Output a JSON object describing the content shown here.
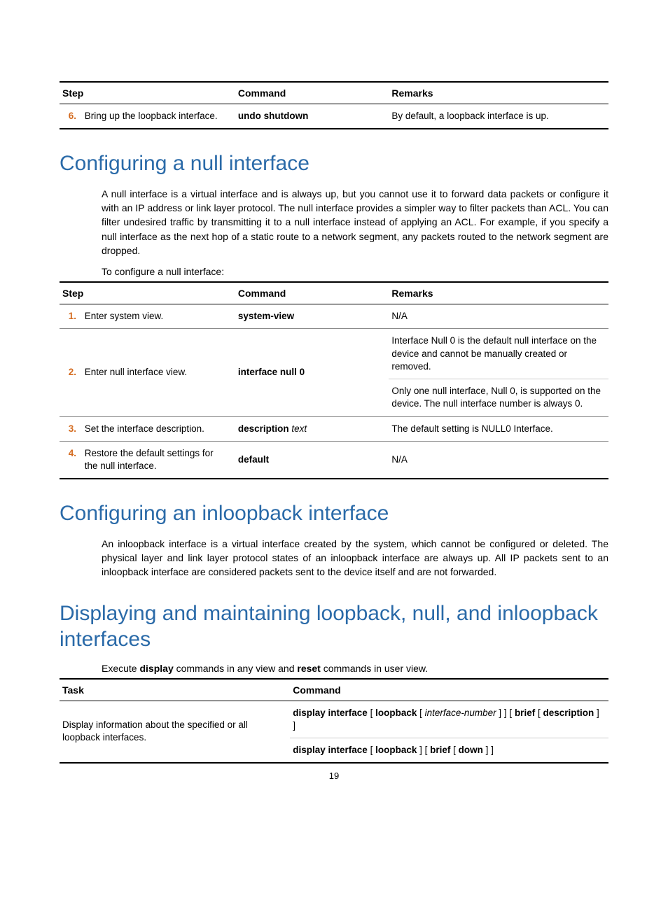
{
  "table1": {
    "headers": {
      "step": "Step",
      "command": "Command",
      "remarks": "Remarks"
    },
    "rows": [
      {
        "num": "6.",
        "step": "Bring up the loopback interface.",
        "command_bold": "undo shutdown",
        "remarks": "By default, a loopback interface is up."
      }
    ]
  },
  "section1": {
    "title": "Configuring a null interface",
    "para": "A null interface is a virtual interface and is always up, but you cannot use it to forward data packets or configure it with an IP address or link layer protocol. The null interface provides a simpler way to filter packets than ACL. You can filter undesired traffic by transmitting it to a null interface instead of applying an ACL. For example, if you specify a null interface as the next hop of a static route to a network segment, any packets routed to the network segment are dropped.",
    "lead": "To configure a null interface:"
  },
  "table2": {
    "headers": {
      "step": "Step",
      "command": "Command",
      "remarks": "Remarks"
    },
    "rows": [
      {
        "num": "1.",
        "step": "Enter system view.",
        "command_bold": "system-view",
        "remarks": "N/A"
      },
      {
        "num": "2.",
        "step": "Enter null interface view.",
        "command_bold": "interface null 0",
        "remarks_a": "Interface Null 0 is the default null interface on the device and cannot be manually created or removed.",
        "remarks_b": "Only one null interface, Null 0, is supported on the device. The null interface number is always 0."
      },
      {
        "num": "3.",
        "step": "Set the interface description.",
        "command_bold": "description",
        "command_ital": "text",
        "remarks": "The default setting is NULL0 Interface."
      },
      {
        "num": "4.",
        "step": "Restore the default settings for the null interface.",
        "command_bold": "default",
        "remarks": "N/A"
      }
    ]
  },
  "section2": {
    "title": "Configuring an inloopback interface",
    "para": "An inloopback interface is a virtual interface created by the system, which cannot be configured or deleted. The physical layer and link layer protocol states of an inloopback interface are always up. All IP packets sent to an inloopback interface are considered packets sent to the device itself and are not forwarded."
  },
  "section3": {
    "title": "Displaying and maintaining loopback, null, and inloopback interfaces",
    "lead_pre": "Execute ",
    "lead_b1": "display",
    "lead_mid": " commands in any view and ",
    "lead_b2": "reset",
    "lead_post": " commands in user view."
  },
  "table3": {
    "headers": {
      "task": "Task",
      "command": "Command"
    },
    "rows": [
      {
        "task": "Display information about the specified or all loopback interfaces.",
        "cmd_a": {
          "t1": "display interface",
          "t2": " [ ",
          "t3": "loopback",
          "t4": " [ ",
          "t5": "interface-number",
          "t6": " ] ] [ ",
          "t7": "brief",
          "t8": " [ ",
          "t9": "description",
          "t10": " ] ]"
        },
        "cmd_b": {
          "t1": "display interface",
          "t2": " [ ",
          "t3": "loopback",
          "t4": " ] [ ",
          "t5": "brief",
          "t6": " [ ",
          "t7": "down",
          "t8": " ] ]"
        }
      }
    ]
  },
  "page_number": "19"
}
